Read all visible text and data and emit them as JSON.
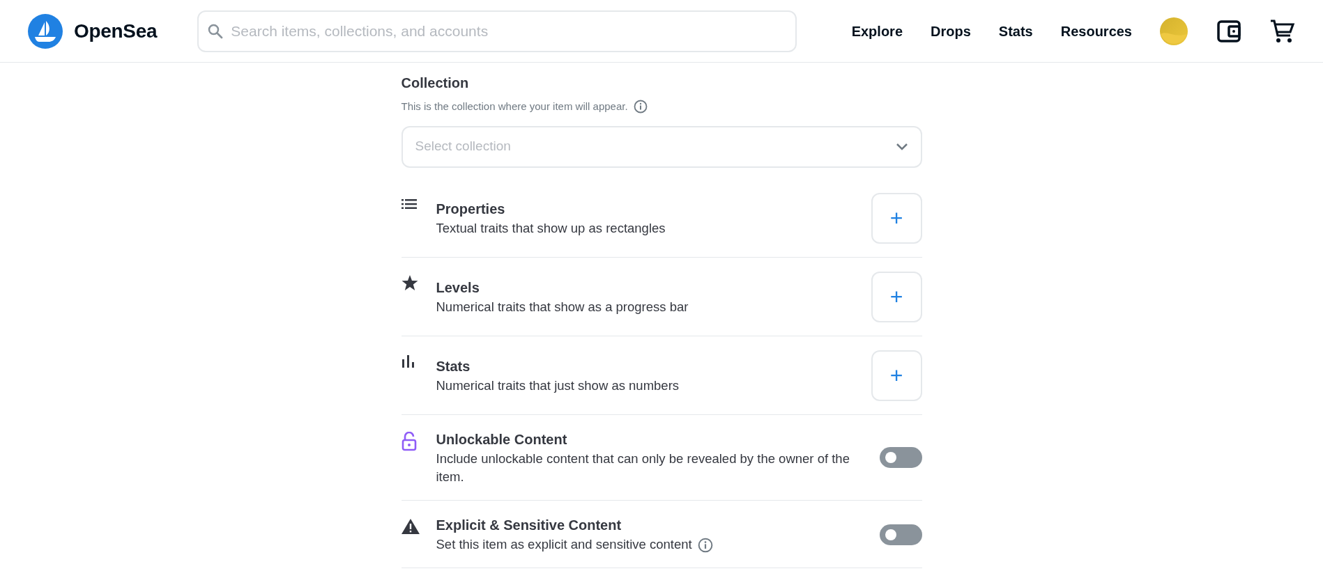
{
  "header": {
    "brand": "OpenSea",
    "search": {
      "placeholder": "Search items, collections, and accounts"
    },
    "nav": [
      "Explore",
      "Drops",
      "Stats",
      "Resources"
    ]
  },
  "collection": {
    "title": "Collection",
    "hint": "This is the collection where your item will appear.",
    "select": {
      "placeholder": "Select collection"
    }
  },
  "sections": [
    {
      "kind": "add",
      "title": "Properties",
      "description": "Textual traits that show up as rectangles",
      "add_button": "+"
    },
    {
      "kind": "add",
      "title": "Levels",
      "description": "Numerical traits that show as a progress bar",
      "add_button": "+"
    },
    {
      "kind": "add",
      "title": "Stats",
      "description": "Numerical traits that just show as numbers",
      "add_button": "+"
    },
    {
      "kind": "toggle",
      "title": "Unlockable Content",
      "description": "Include unlockable content that can only be revealed by the owner of the item.",
      "on": false
    },
    {
      "kind": "toggle",
      "title": "Explicit & Sensitive Content",
      "description": "Set this item as explicit and sensitive content",
      "info": true,
      "on": false
    }
  ]
}
